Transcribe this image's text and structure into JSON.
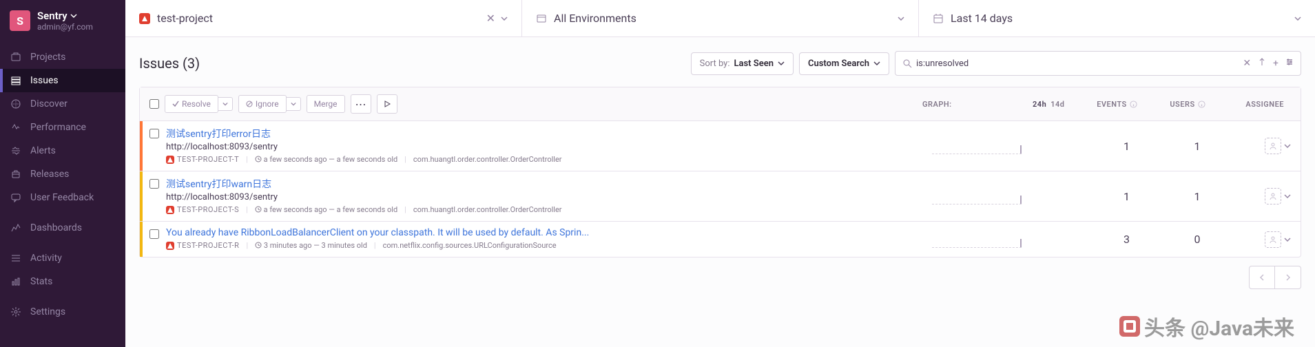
{
  "org": {
    "logo_letter": "S",
    "name": "Sentry",
    "email": "admin@yf.com"
  },
  "sidebar": {
    "items": [
      {
        "label": "Projects"
      },
      {
        "label": "Issues"
      },
      {
        "label": "Discover"
      },
      {
        "label": "Performance"
      },
      {
        "label": "Alerts"
      },
      {
        "label": "Releases"
      },
      {
        "label": "User Feedback"
      },
      {
        "label": "Dashboards"
      },
      {
        "label": "Activity"
      },
      {
        "label": "Stats"
      },
      {
        "label": "Settings"
      }
    ]
  },
  "topbar": {
    "project": "test-project",
    "environment": "All Environments",
    "daterange": "Last 14 days"
  },
  "page": {
    "title": "Issues (3)"
  },
  "controls": {
    "sort_label": "Sort by:",
    "sort_value": "Last Seen",
    "search_type": "Custom Search",
    "search_value": "is:unresolved",
    "resolve": "Resolve",
    "ignore": "Ignore",
    "merge": "Merge"
  },
  "columns": {
    "graph": "GRAPH:",
    "period_active": "24h",
    "period_inactive": "14d",
    "events": "EVENTS",
    "users": "USERS",
    "assignee": "ASSIGNEE"
  },
  "issues": [
    {
      "level": "error",
      "title": "测试sentry打印error日志",
      "url": "http://localhost:8093/sentry",
      "project": "TEST-PROJECT-T",
      "time": "a few seconds ago — a few seconds old",
      "culprit": "com.huangtl.order.controller.OrderController",
      "events": "1",
      "users": "1"
    },
    {
      "level": "warn",
      "title": "测试sentry打印warn日志",
      "url": "http://localhost:8093/sentry",
      "project": "TEST-PROJECT-S",
      "time": "a few seconds ago — a few seconds old",
      "culprit": "com.huangtl.order.controller.OrderController",
      "events": "1",
      "users": "1"
    },
    {
      "level": "warn",
      "title": "You already have RibbonLoadBalancerClient on your classpath. It will be used by default. As Sprin...",
      "url": "",
      "project": "TEST-PROJECT-R",
      "time": "3 minutes ago — 3 minutes old",
      "culprit": "com.netflix.config.sources.URLConfigurationSource",
      "events": "3",
      "users": "0"
    }
  ],
  "watermark": "头条 @Java未来"
}
